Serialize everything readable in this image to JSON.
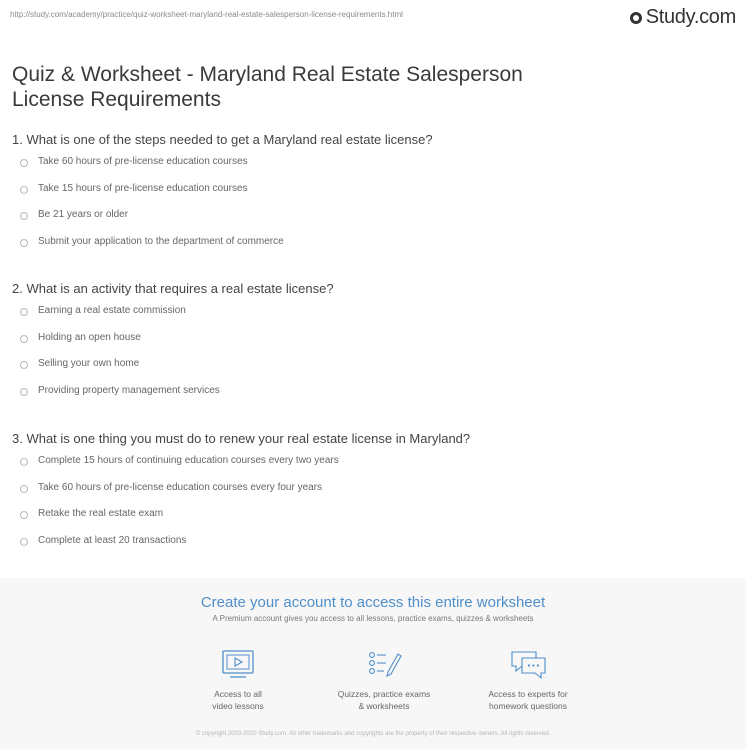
{
  "url": "http://study.com/academy/practice/quiz-worksheet-maryland-real-estate-salesperson-license-requirements.html",
  "brand": "Study.com",
  "title_line1": "Quiz & Worksheet - Maryland Real Estate Salesperson",
  "title_line2": "License Requirements",
  "questions": [
    {
      "text": "1. What is one of the steps needed to get a Maryland real estate license?",
      "options": [
        "Take 60 hours of pre-license education courses",
        "Take 15 hours of pre-license education courses",
        "Be 21 years or older",
        "Submit your application to the department of commerce"
      ]
    },
    {
      "text": "2. What is an activity that requires a real estate license?",
      "options": [
        "Earning a real estate commission",
        "Holding an open house",
        "Selling your own home",
        "Providing property management services"
      ]
    },
    {
      "text": "3. What is one thing you must do to renew your real estate license in Maryland?",
      "options": [
        "Complete 15 hours of continuing education courses every two years",
        "Take 60 hours of pre-license education courses every four years",
        "Retake the real estate exam",
        "Complete at least 20 transactions"
      ]
    }
  ],
  "promo": {
    "title": "Create your account to access this entire worksheet",
    "subtitle": "A Premium account gives you access to all lessons, practice exams, quizzes & worksheets",
    "features": [
      {
        "icon": "video-lesson-icon",
        "caption": "Access to all\nvideo lessons"
      },
      {
        "icon": "quiz-checklist-icon",
        "caption": "Quizzes, practice exams\n& worksheets"
      },
      {
        "icon": "chat-bubble-icon",
        "caption": "Access to experts for\nhomework questions"
      }
    ]
  },
  "footer": "© copyright 2003-2020 Study.com. All other trademarks and copyrights are the property of their respective owners. All rights reserved."
}
